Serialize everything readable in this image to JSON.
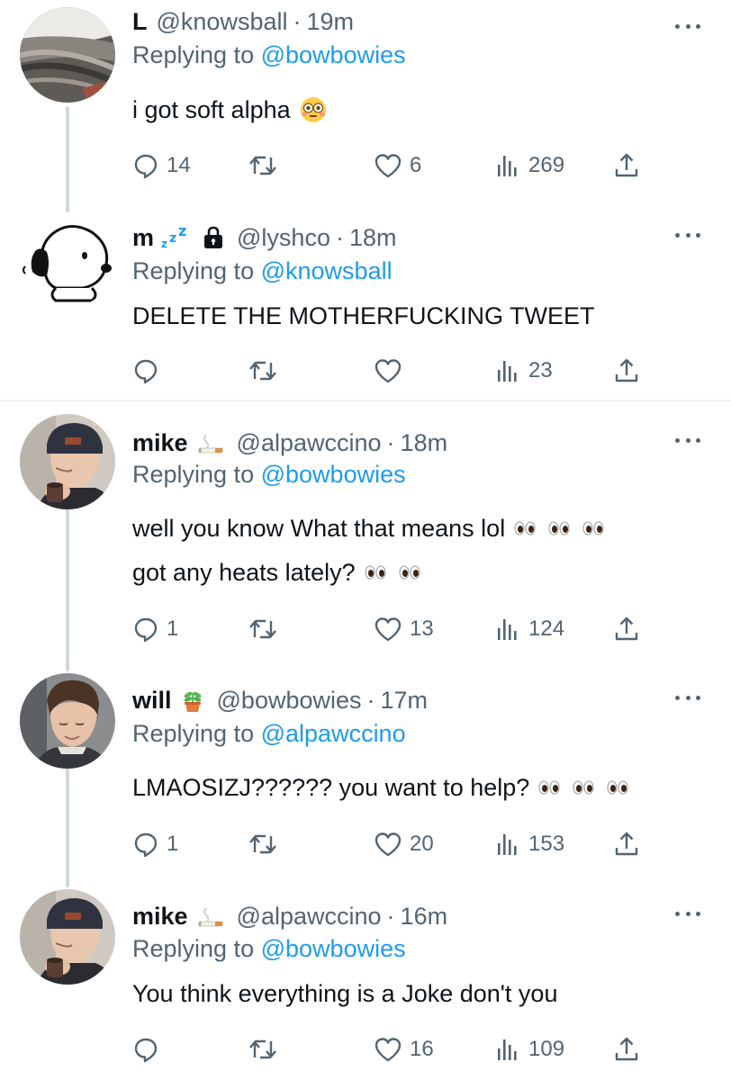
{
  "tweets": [
    {
      "name": "L",
      "handle": "@knowsball",
      "separator": "·",
      "time": "19m",
      "reply_prefix": "Replying to",
      "reply_to": "@bowbowies",
      "lines": [
        "i got soft alpha"
      ],
      "emoji": "flushed-face",
      "replies": "14",
      "retweets": "",
      "likes": "6",
      "views": "269"
    },
    {
      "name": "m",
      "name_suffix": "zzz",
      "handle": "@lyshco",
      "separator": "·",
      "time": "18m",
      "reply_prefix": "Replying to",
      "reply_to": "@knowsball",
      "lines": [
        "DELETE THE MOTHERFUCKING TWEET"
      ],
      "replies": "",
      "retweets": "",
      "likes": "",
      "views": "23"
    },
    {
      "name": "mike",
      "name_emoji": "cigarette",
      "handle": "@alpawccino",
      "separator": "·",
      "time": "18m",
      "reply_prefix": "Replying to",
      "reply_to": "@bowbowies",
      "lines": [
        "well you know What that means lol",
        "got any heats lately?"
      ],
      "replies": "1",
      "retweets": "",
      "likes": "13",
      "views": "124"
    },
    {
      "name": "will",
      "name_emoji": "potted-plant",
      "handle": "@bowbowies",
      "separator": "·",
      "time": "17m",
      "reply_prefix": "Replying to",
      "reply_to": "@alpawccino",
      "lines": [
        "LMAOSIZJ?????? you want to help?"
      ],
      "replies": "1",
      "retweets": "",
      "likes": "20",
      "views": "153"
    },
    {
      "name": "mike",
      "name_emoji": "cigarette",
      "handle": "@alpawccino",
      "separator": "·",
      "time": "16m",
      "reply_prefix": "Replying to",
      "reply_to": "@bowbowies",
      "lines": [
        "You think everything is a Joke don't you"
      ],
      "replies": "",
      "retweets": "",
      "likes": "16",
      "views": "109"
    }
  ],
  "colors": {
    "text": "#0f1419",
    "secondary": "#536471",
    "link": "#1d9bf0",
    "divider": "#eff3f4",
    "thread_line": "#cfd9de"
  }
}
